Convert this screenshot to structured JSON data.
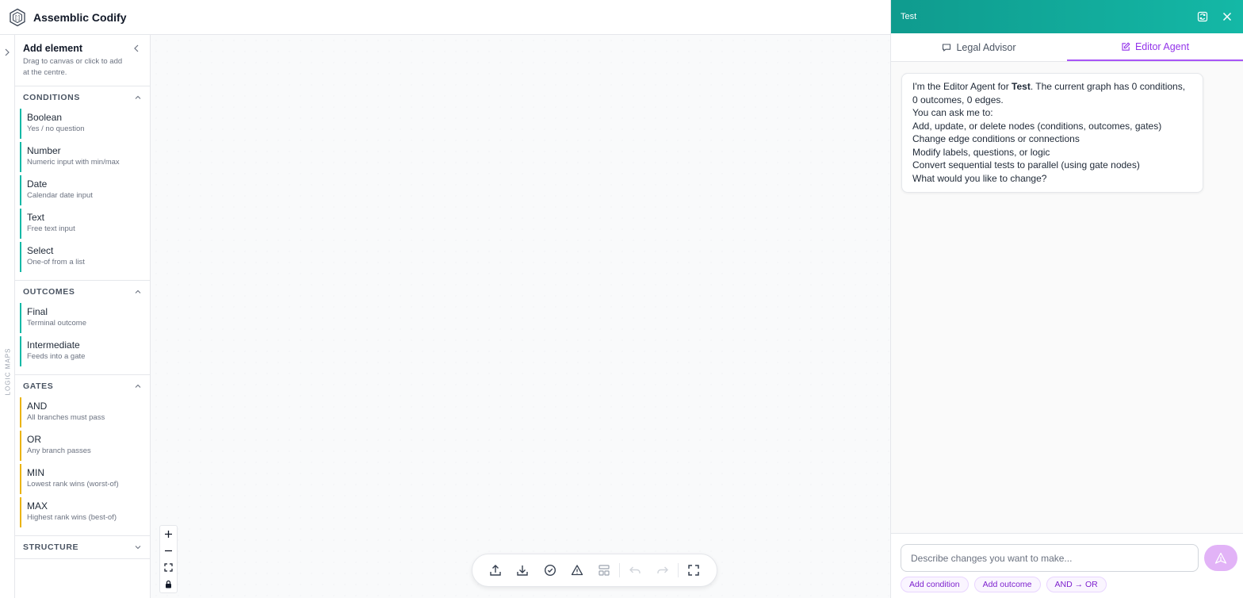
{
  "app": {
    "title": "Assemblic Codify"
  },
  "rail": {
    "label": "LOGIC MAPS"
  },
  "sidebar": {
    "title": "Add element",
    "subtitle": "Drag to canvas or click to add at the centre.",
    "sections": [
      {
        "title": "CONDITIONS",
        "kind": "condition",
        "items": [
          {
            "label": "Boolean",
            "desc": "Yes / no question"
          },
          {
            "label": "Number",
            "desc": "Numeric input with min/max"
          },
          {
            "label": "Date",
            "desc": "Calendar date input"
          },
          {
            "label": "Text",
            "desc": "Free text input"
          },
          {
            "label": "Select",
            "desc": "One-of from a list"
          }
        ]
      },
      {
        "title": "OUTCOMES",
        "kind": "outcome",
        "items": [
          {
            "label": "Final",
            "desc": "Terminal outcome"
          },
          {
            "label": "Intermediate",
            "desc": "Feeds into a gate"
          }
        ]
      },
      {
        "title": "GATES",
        "kind": "gate",
        "items": [
          {
            "label": "AND",
            "desc": "All branches must pass"
          },
          {
            "label": "OR",
            "desc": "Any branch passes"
          },
          {
            "label": "MIN",
            "desc": "Lowest rank wins (worst-of)"
          },
          {
            "label": "MAX",
            "desc": "Highest rank wins (best-of)"
          }
        ]
      },
      {
        "title": "STRUCTURE",
        "kind": "structure",
        "items": []
      }
    ]
  },
  "panel": {
    "title": "Test",
    "tabs": [
      {
        "label": "Legal Advisor"
      },
      {
        "label": "Editor Agent"
      }
    ],
    "message": {
      "intro_prefix": "I'm the Editor Agent for ",
      "intro_name": "Test",
      "intro_suffix": ". The current graph has 0 conditions, 0 outcomes, 0 edges.",
      "lines": [
        "You can ask me to:",
        "Add, update, or delete nodes (conditions, outcomes, gates)",
        "Change edge conditions or connections",
        "Modify labels, questions, or logic",
        "Convert sequential tests to parallel (using gate nodes)",
        "What would you like to change?"
      ]
    },
    "input_placeholder": "Describe changes you want to make...",
    "chips": [
      "Add condition",
      "Add outcome",
      "AND → OR"
    ]
  },
  "colors": {
    "teal": "#14b8a6",
    "gate": "#eab308",
    "accent": "#a855f7"
  }
}
